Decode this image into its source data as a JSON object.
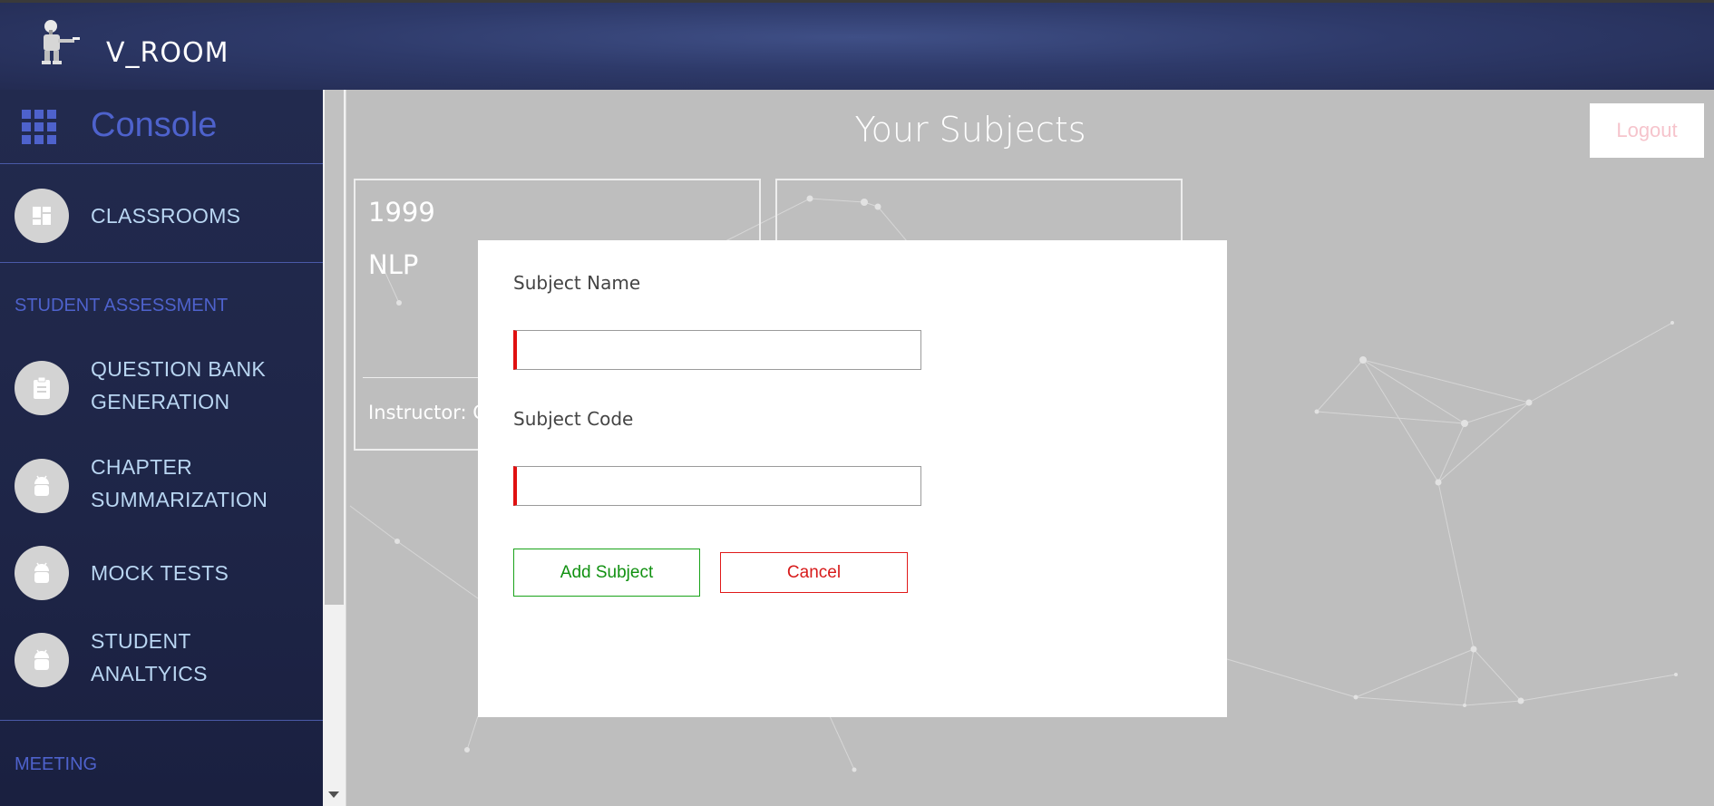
{
  "app": {
    "title": "V_ROOM"
  },
  "sidebar": {
    "console_label": "Console",
    "items": [
      {
        "label": "CLASSROOMS",
        "icon": "dashboard-icon"
      },
      {
        "label": "QUESTION BANK GENERATION",
        "icon": "clipboard-icon"
      },
      {
        "label": "CHAPTER SUMMARIZATION",
        "icon": "android-icon"
      },
      {
        "label": "MOCK TESTS",
        "icon": "android-icon"
      },
      {
        "label": "STUDENT ANALTYICS",
        "icon": "android-icon"
      }
    ],
    "sections": {
      "student_assessment": "STUDENT ASSESSMENT",
      "meeting": "MEETING"
    }
  },
  "header": {
    "page_title": "Your Subjects",
    "logout_label": "Logout"
  },
  "cards": [
    {
      "code": "1999",
      "name": "NLP",
      "instructor": "Instructor: Ca"
    }
  ],
  "modal": {
    "subject_name_label": "Subject Name",
    "subject_name_value": "",
    "subject_code_label": "Subject Code",
    "subject_code_value": "",
    "add_label": "Add Subject",
    "cancel_label": "Cancel"
  },
  "colors": {
    "accent": "#4e62cc",
    "sidebar_text": "#b9d6f2",
    "add_green": "#119111",
    "cancel_red": "#d71a1a",
    "logout_pink": "#f6c4cc"
  }
}
